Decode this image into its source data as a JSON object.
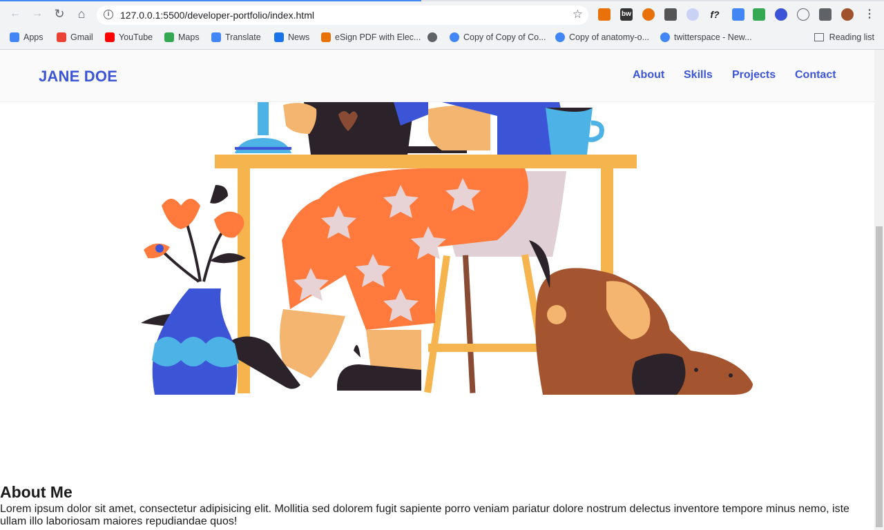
{
  "browser": {
    "url_host": "127.0.0.1",
    "url_path": ":5500/developer-portfolio/index.html",
    "back_icon": "←",
    "forward_icon": "→",
    "reload_icon": "↻",
    "home_icon": "⌂",
    "star_icon": "☆",
    "info_icon": "i",
    "bookmarks": [
      {
        "label": "Apps",
        "color": "#4285f4"
      },
      {
        "label": "Gmail",
        "color": "#ea4335"
      },
      {
        "label": "YouTube",
        "color": "#ff0000"
      },
      {
        "label": "Maps",
        "color": "#34a853"
      },
      {
        "label": "Translate",
        "color": "#4285f4"
      },
      {
        "label": "News",
        "color": "#1a73e8"
      },
      {
        "label": "eSign PDF with Elec...",
        "color": "#e8710a"
      },
      {
        "label": "",
        "color": "#5f6368"
      },
      {
        "label": "Copy of Copy of Co...",
        "color": "#4285f4"
      },
      {
        "label": "Copy of anatomy-o...",
        "color": "#4285f4"
      },
      {
        "label": "twitterspace - New...",
        "color": "#4285f4"
      }
    ],
    "reading_list": "Reading list"
  },
  "site": {
    "logo": "JANE DOE",
    "nav": [
      "About",
      "Skills",
      "Projects",
      "Contact"
    ],
    "brand_color": "#3b55d6"
  },
  "about": {
    "title": "About Me",
    "text": "Lorem ipsum dolor sit amet, consectetur adipisicing elit. Mollitia sed dolorem fugit sapiente porro veniam pariatur dolore nostrum delectus inventore tempore minus nemo, iste ullam illo laboriosam maiores repudiandae quos!"
  }
}
